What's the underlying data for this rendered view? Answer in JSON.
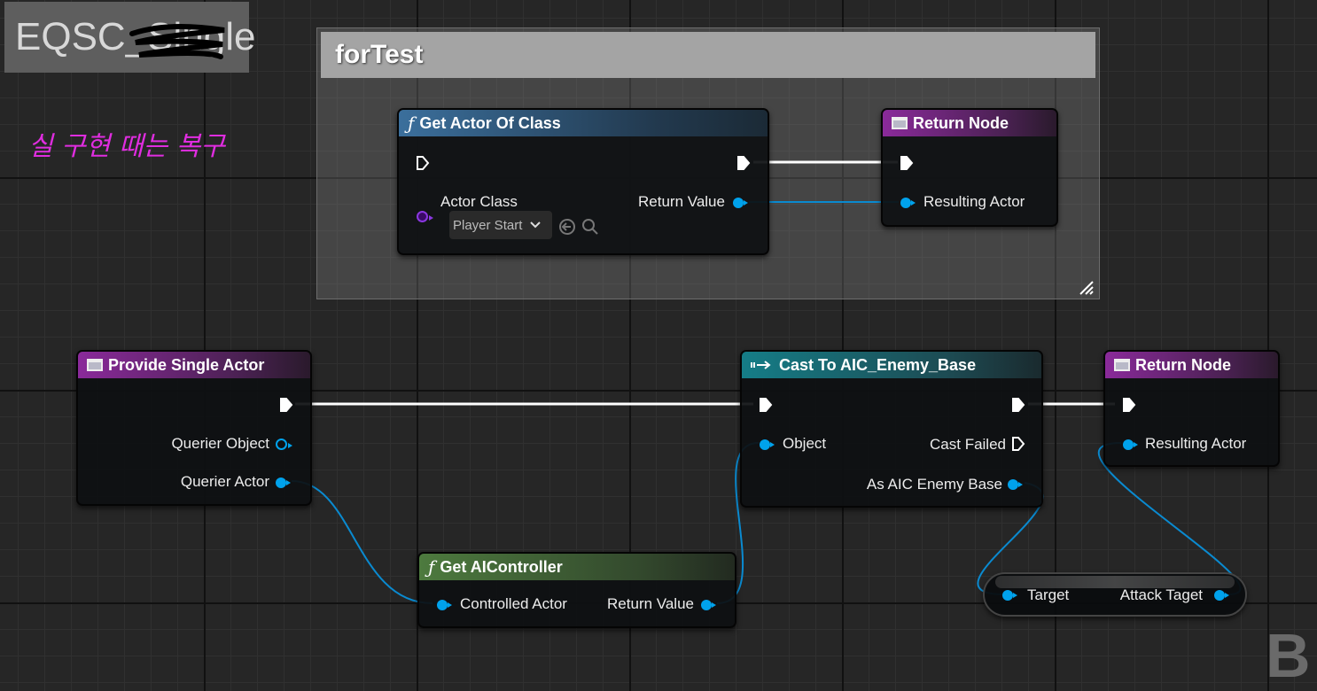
{
  "blueprint_title": "EQSC_Single",
  "note": "실 구현 때는 복구",
  "comment": {
    "title": "forTest"
  },
  "nodes": {
    "get_actor_of_class": {
      "title": "Get Actor Of Class",
      "actor_class_label": "Actor Class",
      "actor_class_value": "Player Start",
      "return_value": "Return Value"
    },
    "return_node_top": {
      "title": "Return Node",
      "resulting_actor": "Resulting Actor"
    },
    "provide_single_actor": {
      "title": "Provide Single Actor",
      "querier_object": "Querier Object",
      "querier_actor": "Querier Actor"
    },
    "cast": {
      "title": "Cast To AIC_Enemy_Base",
      "object": "Object",
      "cast_failed": "Cast Failed",
      "as": "As AIC Enemy Base"
    },
    "return_node_bottom": {
      "title": "Return Node",
      "resulting_actor": "Resulting Actor"
    },
    "get_aicontroller": {
      "title": "Get AIController",
      "controlled_actor": "Controlled Actor",
      "return_value": "Return Value"
    },
    "attack_target": {
      "target": "Target",
      "attack_taget": "Attack Taget"
    }
  },
  "colors": {
    "object_pin": "#00a2ec",
    "class_pin": "#8a37e0",
    "note": "#e02de0",
    "exec": "#ffffff"
  },
  "watermark": "B"
}
